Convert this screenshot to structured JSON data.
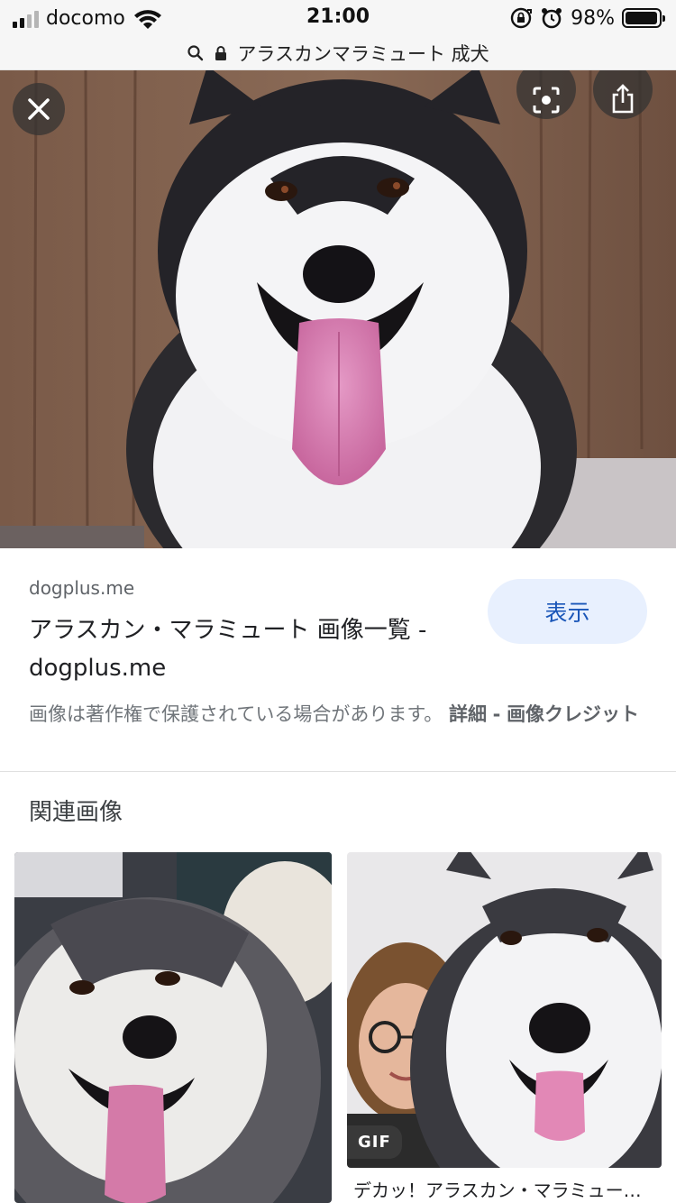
{
  "status_bar": {
    "carrier": "docomo",
    "time": "21:00",
    "battery_percent": "98%",
    "battery_level": 0.98,
    "icons": [
      "signal-icon",
      "wifi-icon",
      "rotation-lock-icon",
      "alarm-icon",
      "battery-icon"
    ]
  },
  "url_bar": {
    "text": "アラスカンマラミュート 成犬",
    "icons": [
      "search-icon",
      "lock-icon"
    ]
  },
  "viewer": {
    "close_icon": "close-icon",
    "lens_icon": "lens-icon",
    "share_icon": "share-icon"
  },
  "result": {
    "domain": "dogplus.me",
    "title": "アラスカン・マラミュート 画像一覧 - dogplus.me",
    "show_button": "表示",
    "copyright_notice": "画像は著作権で保護されている場合があります。",
    "details_link": "詳細",
    "separator": "-",
    "credits_link": "画像クレジット"
  },
  "related": {
    "heading": "関連画像",
    "items": [
      {
        "caption": ""
      },
      {
        "badge": "GIF",
        "caption": "デカッ！アラスカン・マラミュー…"
      }
    ]
  },
  "colors": {
    "show_button_bg": "#e8f0fe",
    "show_button_text": "#1a56b8",
    "muted_text": "#70757a"
  }
}
